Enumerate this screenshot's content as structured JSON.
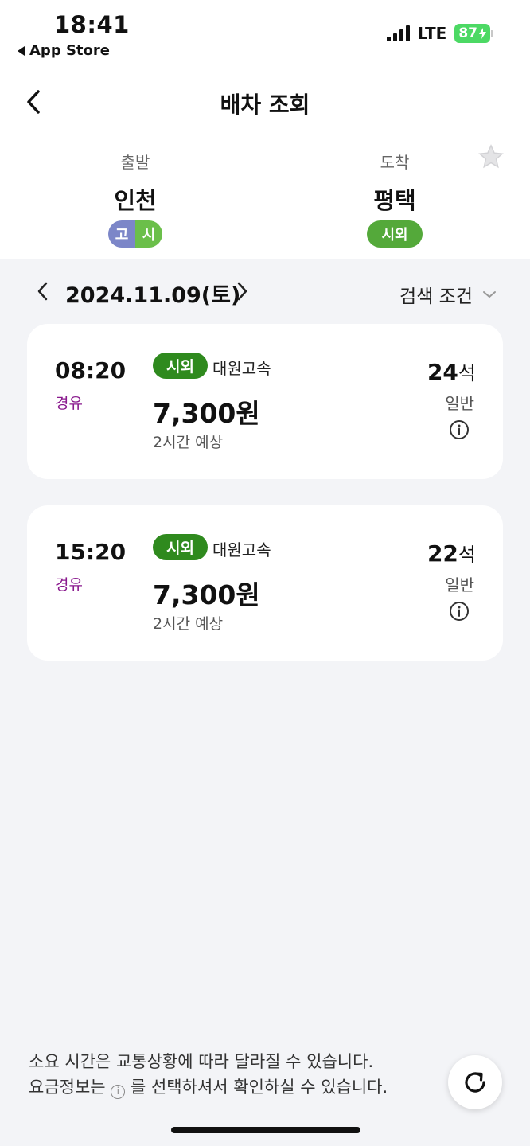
{
  "status_bar": {
    "time": "18:41",
    "back_app": "App Store",
    "network": "LTE",
    "battery": "87"
  },
  "header": {
    "title": "배차 조회"
  },
  "route": {
    "departure_label": "출발",
    "departure_city": "인천",
    "departure_badges": [
      "고",
      "시"
    ],
    "arrival_label": "도착",
    "arrival_city": "평택",
    "arrival_badge": "시외"
  },
  "date_bar": {
    "date": "2024.11.09(토)",
    "search_conditions": "검색 조건"
  },
  "buses": [
    {
      "time": "08:20",
      "via": "경유",
      "type": "시외",
      "company": "대원고속",
      "price": "7,300원",
      "duration": "2시간 예상",
      "seats": "24",
      "seats_unit": "석",
      "grade": "일반"
    },
    {
      "time": "15:20",
      "via": "경유",
      "type": "시외",
      "company": "대원고속",
      "price": "7,300원",
      "duration": "2시간 예상",
      "seats": "22",
      "seats_unit": "석",
      "grade": "일반"
    }
  ],
  "notice": {
    "line1": "소요 시간은 교통상황에 따라 달라질 수 있습니다.",
    "line2_prefix": "요금정보는",
    "line2_icon": "ⓘ",
    "line2_suffix": "를 선택하셔서 확인하실 수 있습니다."
  },
  "colors": {
    "via": "#8a1a8e",
    "badge_green": "#2f8a1e",
    "badge_go": "#7c86c8"
  }
}
